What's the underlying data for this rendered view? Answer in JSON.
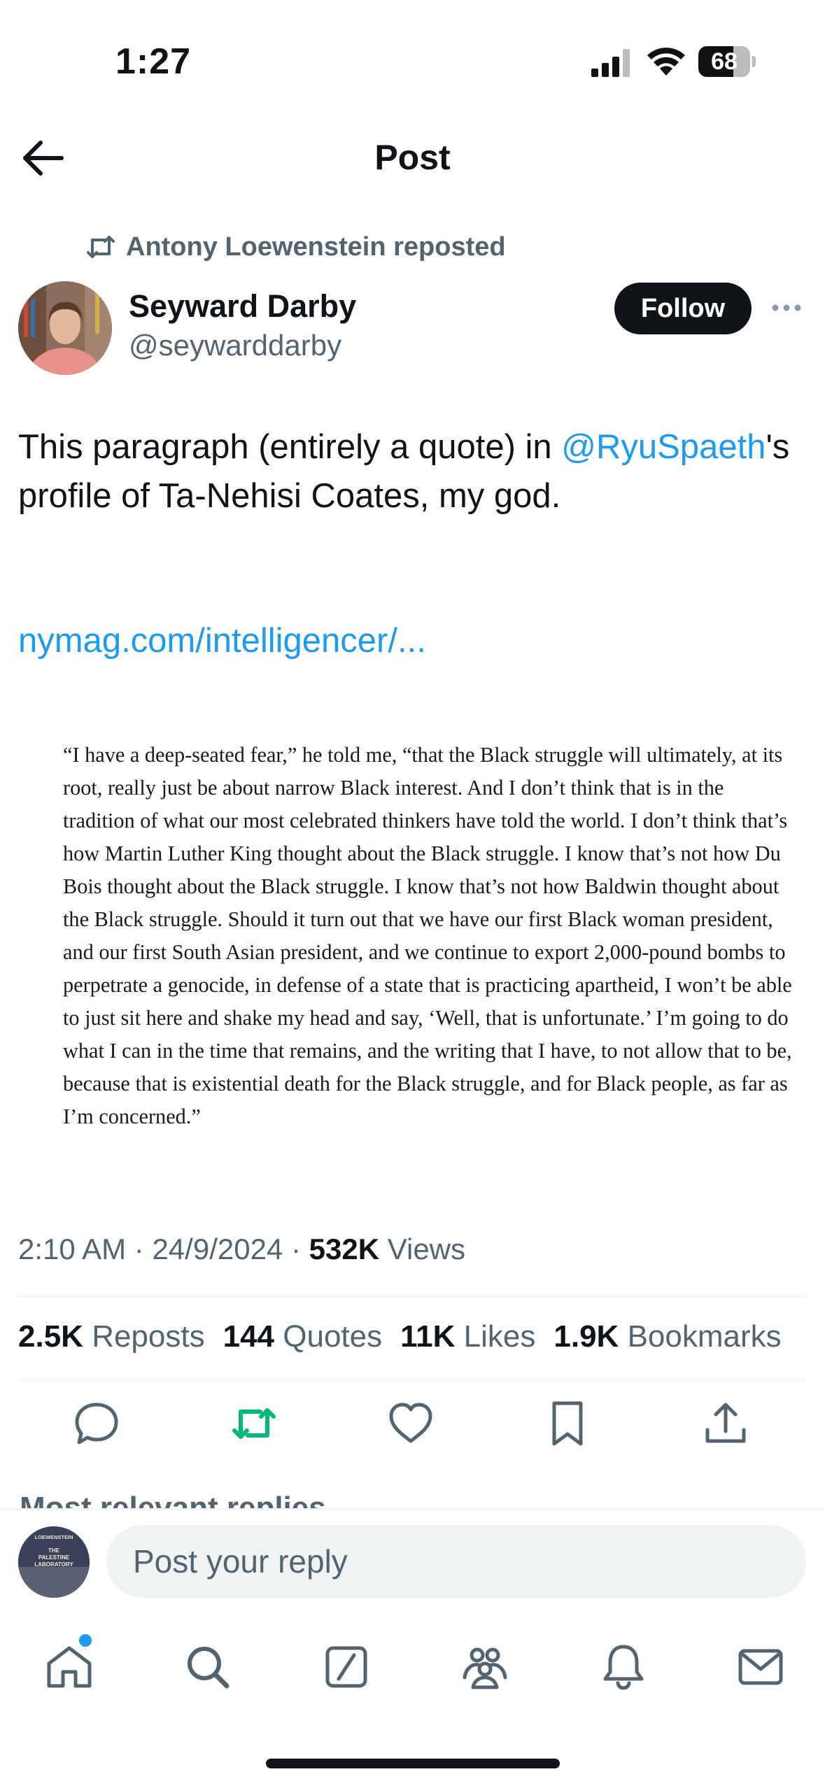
{
  "status_bar": {
    "time": "1:27",
    "battery": "68",
    "battery_level": 0.68
  },
  "header": {
    "title": "Post"
  },
  "repost": {
    "text": "Antony Loewenstein reposted"
  },
  "author": {
    "name": "Seyward Darby",
    "handle": "@seywarddarby",
    "follow_label": "Follow"
  },
  "post": {
    "text_before": "This paragraph (entirely a quote) in ",
    "mention": "@RyuSpaeth",
    "text_after": "'s profile of Ta-Nehisi Coates, my god.",
    "link": "nymag.com/intelligencer/...",
    "quote_image_text": "“I have a deep-seated fear,” he told me, “that the Black struggle will ultimately, at its root, really just be about narrow Black interest. And I don’t think that is in the tradition of what our most celebrated thinkers have told the world. I don’t think that’s how Martin Luther King thought about the Black struggle. I know that’s not how Du Bois thought about the Black struggle. I know that’s not how Baldwin thought about the Black struggle. Should it turn out that we have our first Black woman president, and our first South Asian president, and we continue to export 2,000-pound bombs to perpetrate a genocide, in defense of a state that is practicing apartheid, I won’t be able to just sit here and shake my head and say, ‘Well, that is unfortunate.’ I’m going to do what I can in the time that remains, and the writing that I have, to not allow that to be, because that is existential death for the Black struggle, and for Black people, as far as I’m concerned.”"
  },
  "meta": {
    "time": "2:10 AM",
    "date": "24/9/2024",
    "views_count": "532K",
    "views_label": "Views",
    "separator": "·"
  },
  "stats": {
    "reposts_count": "2.5K",
    "reposts_label": "Reposts",
    "quotes_count": "144",
    "quotes_label": "Quotes",
    "likes_count": "11K",
    "likes_label": "Likes",
    "bookmarks_count": "1.9K",
    "bookmarks_label": "Bookmarks"
  },
  "actions": {
    "icons": [
      "reply-icon",
      "repost-icon",
      "like-icon",
      "bookmark-icon",
      "share-icon"
    ],
    "repost_color": "#00ba7c"
  },
  "replies": {
    "label": "Most relevant replies ⌄"
  },
  "reply_bar": {
    "placeholder": "Post your reply",
    "avatar_text_top": "LOEWENSTEIN",
    "avatar_text_main": "THE PALESTINE LABORATORY"
  },
  "bottom_nav": {
    "items": [
      "home-icon",
      "search-icon",
      "grok-icon",
      "communities-icon",
      "notifications-icon",
      "messages-icon"
    ]
  },
  "colors": {
    "accent": "#1d9bf0",
    "secondary_text": "#536471",
    "primary_text": "#0f1419"
  }
}
